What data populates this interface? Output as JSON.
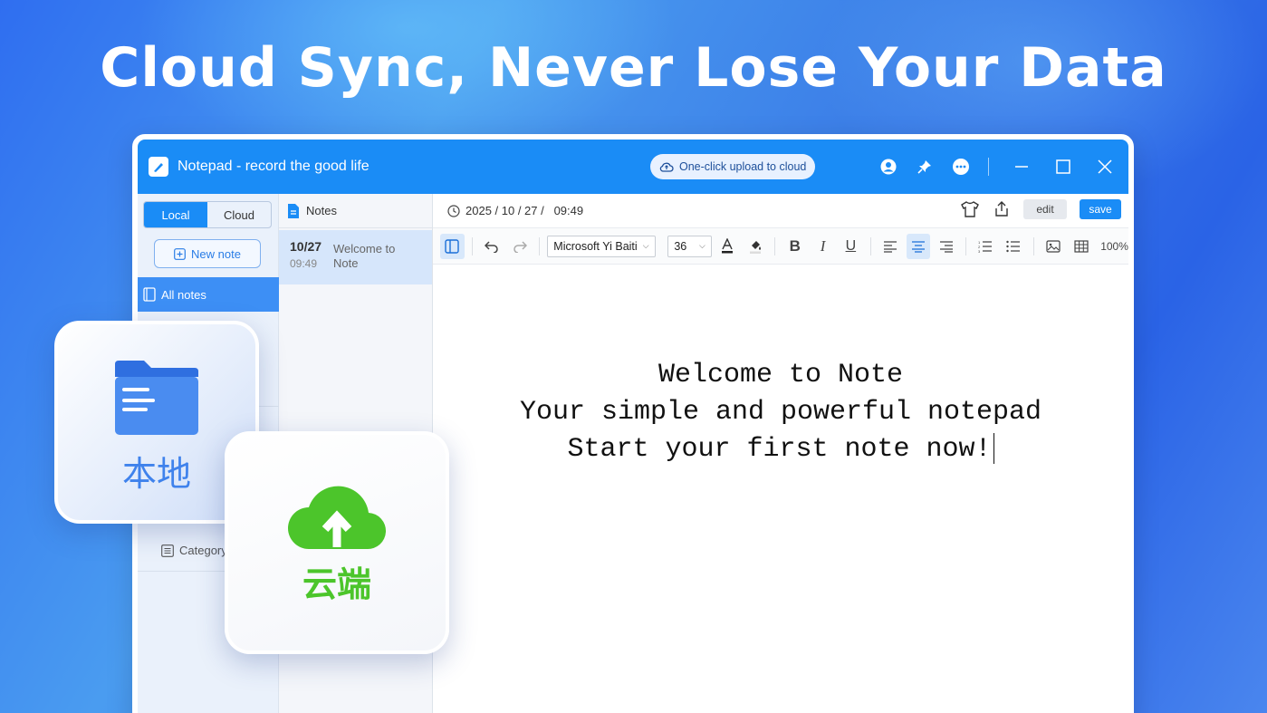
{
  "headline": "Cloud Sync, Never Lose Your Data",
  "colors": {
    "accent": "#1a8cf6",
    "cloud_green": "#4cc52b",
    "local_blue": "#3f82ec"
  },
  "window": {
    "title": "Notepad - record the good life",
    "upload_button": "One-click upload to cloud",
    "icons": [
      "user-icon",
      "pin-icon",
      "more-icon",
      "minimize-icon",
      "maximize-icon",
      "close-icon"
    ]
  },
  "sidebar": {
    "tabs": [
      {
        "label": "Local",
        "active": true
      },
      {
        "label": "Cloud",
        "active": false
      }
    ],
    "new_note": "New note",
    "all_notes": "All notes",
    "category": "Category"
  },
  "notes": {
    "header": "Notes",
    "items": [
      {
        "date": "10/27",
        "time": "09:49",
        "title": "Welcome to Note"
      }
    ]
  },
  "editor": {
    "timestamp": "2025 / 10 / 27 /   09:49",
    "edit_label": "edit",
    "save_label": "save",
    "font": "Microsoft Yi Baiti",
    "font_size": "36",
    "zoom": "100%",
    "lines": [
      "Welcome to Note",
      "Your simple and powerful notepad",
      "Start your first note now!"
    ]
  },
  "cards": {
    "local_label": "本地",
    "cloud_label": "云端"
  }
}
